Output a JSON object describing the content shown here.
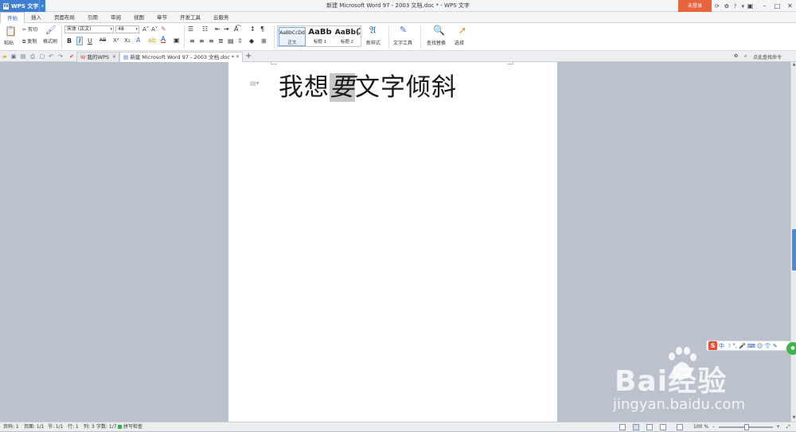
{
  "titlebar": {
    "app_button": "WPS 文字",
    "window_title": "新建 Microsoft Word 97 - 2003 文档.doc * - WPS 文字",
    "login": "未登录"
  },
  "menu": {
    "tabs": [
      "开始",
      "插入",
      "页面布局",
      "引用",
      "审阅",
      "视图",
      "章节",
      "开发工具",
      "云服务"
    ]
  },
  "ribbon": {
    "paste": "粘贴",
    "cut": "剪切",
    "copy": "复制",
    "format_painter": "格式刷",
    "font_name": "宋体 (正文)",
    "font_size": "48",
    "bold": "B",
    "italic": "I",
    "underline": "U",
    "strike": "AB",
    "superscript": "X²",
    "subscript": "X₂",
    "styles": [
      {
        "preview": "AaBbCcDd",
        "name": "正文"
      },
      {
        "preview": "AaBb",
        "name": "标题 1"
      },
      {
        "preview": "AaBb(",
        "name": "标题 2"
      }
    ],
    "new_style": "新样式",
    "text_tools": "文字工具",
    "find_replace": "查找替换",
    "select": "选择"
  },
  "tabbar": {
    "tabs": [
      {
        "label": "我的WPS",
        "active": false
      },
      {
        "label": "新建 Microsoft Word 97 - 2003 文档.doc *",
        "active": true
      }
    ],
    "add": "+",
    "search_cmd": "点此查找命令"
  },
  "document": {
    "text_before": "我想",
    "text_highlighted": "要",
    "text_after": "文字倾斜"
  },
  "ime": {
    "label": "中"
  },
  "watermark": {
    "brand": "Bai经验",
    "url": "jingyan.baidu.com"
  },
  "status": {
    "page_code": "页码: 1",
    "page": "页面: 1/1",
    "section": "节: 1/1",
    "line": "行: 1",
    "column": "列: 3",
    "word_count": "字数: 1/7",
    "spell_check": "拼写检查",
    "zoom": "100 %"
  },
  "colors": {
    "accent": "#3e7fd2",
    "login": "#e8633e",
    "highlight": "#c8c8c8"
  }
}
